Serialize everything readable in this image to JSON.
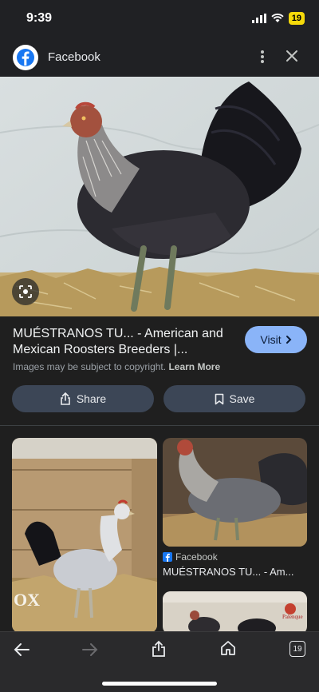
{
  "status_bar": {
    "time": "9:39",
    "battery": "19"
  },
  "header": {
    "title": "Facebook"
  },
  "result": {
    "title": "MUÉSTRANOS TU... - American and Mexican Roosters Breeders |...",
    "visit_label": "Visit",
    "copyright_text": "Images may be subject to copyright.",
    "learn_more_label": "Learn More",
    "share_label": "Share",
    "save_label": "Save"
  },
  "related": [
    {
      "overlay_text": "ox"
    },
    {
      "source": "Facebook",
      "title": "MUÉSTRANOS TU... - Am..."
    },
    {
      "overlay_text": ""
    }
  ],
  "bottom_bar": {
    "tabs_count": "19"
  },
  "colors": {
    "accent": "#8ab4f8",
    "button_bg": "#3c4656",
    "background": "#1f1f1f"
  }
}
